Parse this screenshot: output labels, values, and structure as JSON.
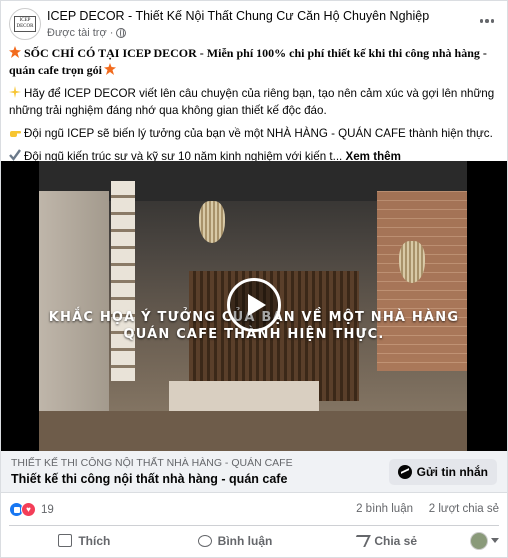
{
  "post": {
    "page_name": "ICEP DECOR - Thiết Kế Nội Thất Chung Cư Căn Hộ Chuyên Nghiệp",
    "sponsored": "Được tài trợ",
    "avatar_text_1": "ICEP",
    "avatar_text_2": "DECOR",
    "text": {
      "line1": "SỐC CHỈ CÓ TẠI ICEP DECOR - Miễn phí 100% chi phí thiết kế khi thi công nhà hàng - quán cafe trọn gói",
      "line2": "Hãy để ICEP DECOR viết lên câu chuyện của riêng bạn, tạo nên cảm xúc và gợi lên những những trải nghiệm đáng nhớ qua không gian thiết kế độc đáo.",
      "line3": "Đội ngũ ICEP sẽ biến lý tưởng của bạn về một NHÀ HÀNG - QUÁN CAFE thành hiện thực.",
      "line4": "Đội ngũ kiến trúc sư và kỹ sư 10 năm kinh nghiệm với kiến t...",
      "see_more": "Xem thêm"
    },
    "video": {
      "caption_line1": "KHẮC HỌA Ý TƯỞNG CỦA BẠN VỀ MỘT NHÀ HÀNG",
      "caption_line2": "QUÁN CAFE THÀNH HIỆN THỰC."
    },
    "link": {
      "domain": "THIẾT KẾ THI CÔNG NỘI THẤT NHÀ HÀNG - QUÁN CAFE",
      "title": "Thiết kế thi công nội thất nhà hàng - quán cafe",
      "cta": "Gửi tin nhắn"
    },
    "stats": {
      "reactions": "19",
      "comments": "2 bình luận",
      "shares": "2 lượt chia sẻ"
    },
    "actions": {
      "like": "Thích",
      "comment": "Bình luận",
      "share": "Chia sẻ"
    }
  },
  "colors": {
    "accent": "#1877f2",
    "love": "#f33e58",
    "secondary_text": "#65676b"
  }
}
